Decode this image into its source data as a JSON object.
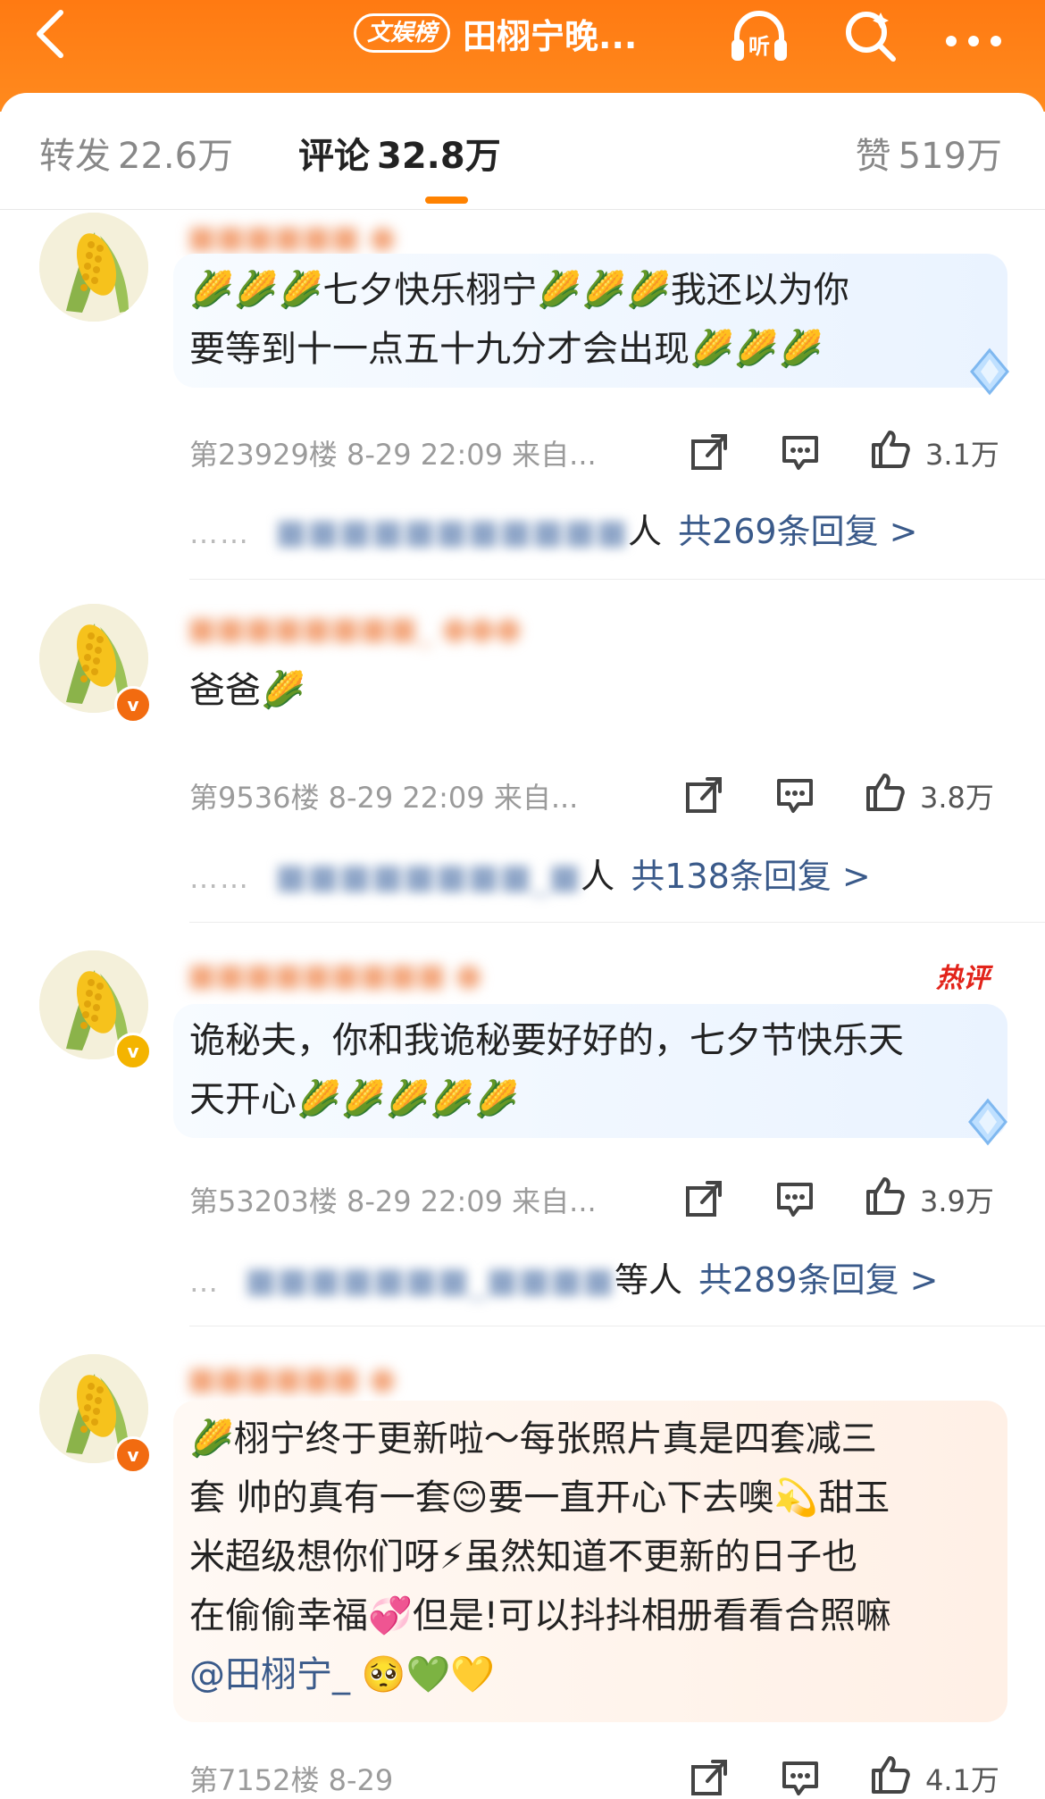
{
  "header": {
    "badge": "文娱榜",
    "title": "田栩宁晚...",
    "listen_label": "听",
    "icons": [
      "back-icon",
      "headphones-icon",
      "search-icon",
      "more-icon"
    ]
  },
  "tabs": {
    "forward_label": "转发",
    "forward_count": "22.6万",
    "comment_label": "评论",
    "comment_count": "32.8万",
    "like_label": "赞",
    "like_count": "519万"
  },
  "comments": [
    {
      "lines": [
        "🌽🌽🌽七夕快乐栩宁🌽🌽🌽我还以为你",
        "要等到十一点五十九分才会出现🌽🌽🌽"
      ],
      "floor": "第23929楼",
      "time": "8-29 22:09",
      "source": "来自...",
      "likes": "3.1万",
      "reply_dots": "……",
      "reply_suffix": "人",
      "reply_link": "共269条回复 >"
    },
    {
      "lines": [
        "爸爸🌽"
      ],
      "floor": "第9536楼",
      "time": "8-29 22:09",
      "source": "来自...",
      "likes": "3.8万",
      "reply_dots": "……",
      "reply_suffix": "人",
      "reply_link": "共138条回复 >"
    },
    {
      "hot_tag": "热评",
      "lines": [
        "诡秘夫，你和我诡秘要好好的，七夕节快乐天",
        "天开心🌽🌽🌽🌽🌽"
      ],
      "floor": "第53203楼",
      "time": "8-29 22:09",
      "source": "来自...",
      "likes": "3.9万",
      "reply_dots": "…",
      "reply_suffix": "等人",
      "reply_link": "共289条回复 >"
    },
    {
      "lines": [
        "🌽栩宁终于更新啦～每张照片真是四套减三",
        "套 帅的真有一套😊要一直开心下去噢💫甜玉",
        "米超级想你们呀⚡虽然知道不更新的日子也",
        "在偷偷幸福💞但是!可以抖抖相册看看合照嘛"
      ],
      "mention": "@田栩宁_",
      "mention_emoji": "🥺💚💛",
      "floor": "第7152楼",
      "time": "8-29",
      "source": "",
      "likes": "4.1万"
    }
  ],
  "colors": {
    "header_orange": "#ff7a12",
    "tab_underline": "#ff8200",
    "link_blue": "#3a5a8a",
    "hot_red": "#e2231a"
  }
}
